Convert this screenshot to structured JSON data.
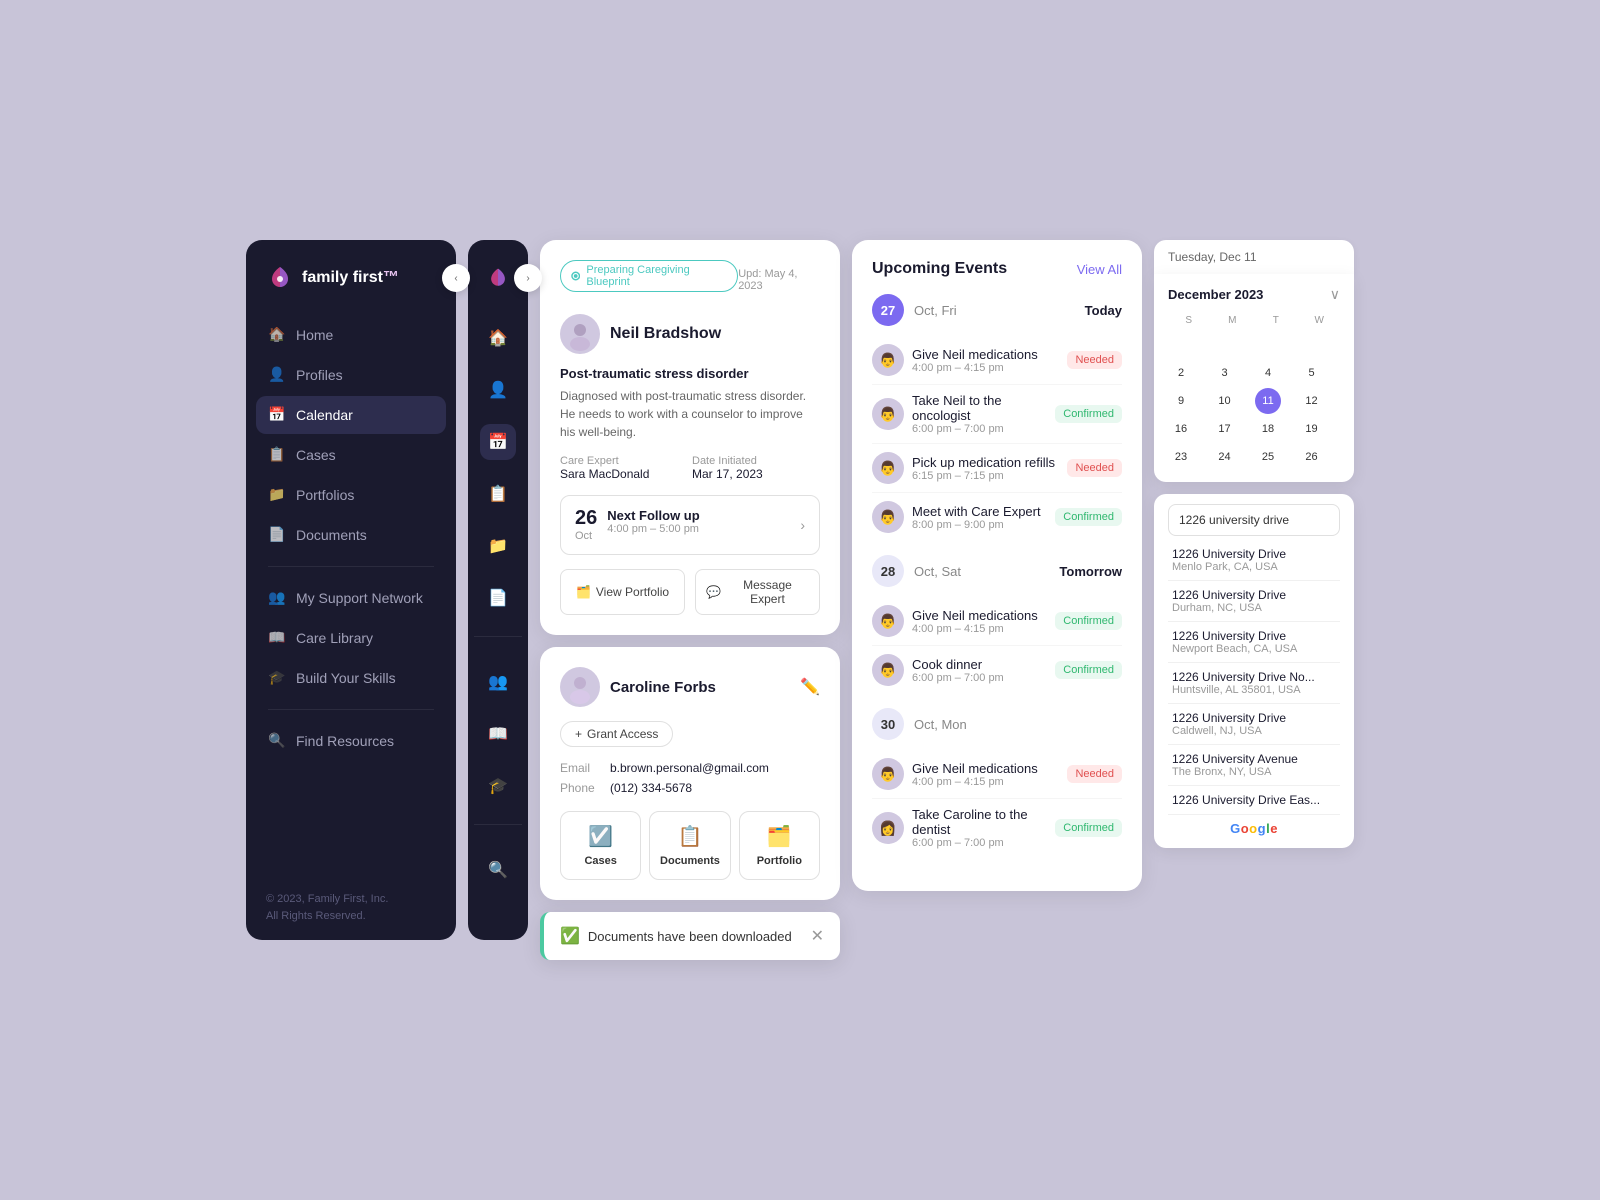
{
  "app": {
    "name": "family first",
    "trademark": "™",
    "copyright": "© 2023, Family First, Inc.\nAll Rights Reserved."
  },
  "sidebar": {
    "nav_items": [
      {
        "id": "home",
        "label": "Home",
        "icon": "🏠",
        "active": false
      },
      {
        "id": "profiles",
        "label": "Profiles",
        "icon": "👤",
        "active": false
      },
      {
        "id": "calendar",
        "label": "Calendar",
        "icon": "📅",
        "active": true
      },
      {
        "id": "cases",
        "label": "Cases",
        "icon": "📋",
        "active": false
      },
      {
        "id": "portfolios",
        "label": "Portfolios",
        "icon": "📁",
        "active": false
      },
      {
        "id": "documents",
        "label": "Documents",
        "icon": "📄",
        "active": false
      }
    ],
    "secondary_items": [
      {
        "id": "support",
        "label": "My Support Network",
        "icon": "👥",
        "active": false
      },
      {
        "id": "library",
        "label": "Care Library",
        "icon": "📖",
        "active": false
      },
      {
        "id": "skills",
        "label": "Build Your Skills",
        "icon": "🎓",
        "active": false
      }
    ],
    "tertiary_items": [
      {
        "id": "find",
        "label": "Find Resources",
        "icon": "🔍",
        "active": false
      }
    ]
  },
  "blueprint_card": {
    "tag": "Preparing Caregiving Blueprint",
    "update_date": "Upd: May 4, 2023",
    "person_name": "Neil Bradshow",
    "diagnosis_label": "Post-traumatic stress disorder",
    "diagnosis_text": "Diagnosed with post-traumatic stress disorder. He needs to work with a counselor to improve his well-being.",
    "care_expert_label": "Care Expert",
    "care_expert_value": "Sara MacDonald",
    "date_initiated_label": "Date Initiated",
    "date_initiated_value": "Mar 17, 2023",
    "followup_day": "26",
    "followup_month": "Oct",
    "followup_title": "Next Follow up",
    "followup_time": "4:00 pm – 5:00 pm",
    "view_portfolio_btn": "View Portfolio",
    "message_expert_btn": "Message Expert"
  },
  "contact_card": {
    "person_name": "Caroline Forbs",
    "grant_btn": "Grant Access",
    "email_label": "Email",
    "email_value": "b.brown.personal@gmail.com",
    "phone_label": "Phone",
    "phone_value": "(012) 334-5678",
    "actions": [
      {
        "id": "cases",
        "label": "Cases"
      },
      {
        "id": "documents",
        "label": "Documents"
      },
      {
        "id": "portfolio",
        "label": "Portfolio"
      }
    ]
  },
  "toast": {
    "message": "Documents have been downloaded"
  },
  "events": {
    "title": "Upcoming Events",
    "view_all": "View All",
    "sections": [
      {
        "day": "27",
        "date_label": "Oct, Fri",
        "day_marker": "Today",
        "items": [
          {
            "name": "Give Neil medications",
            "time": "4:00 pm – 4:15 pm",
            "status": "Needed"
          },
          {
            "name": "Take Neil to the oncologist",
            "time": "6:00 pm – 7:00 pm",
            "status": "Confirmed"
          },
          {
            "name": "Pick up medication refills",
            "time": "6:15 pm – 7:15 pm",
            "status": "Needed"
          },
          {
            "name": "Meet with Care Expert",
            "time": "8:00 pm – 9:00 pm",
            "status": "Confirmed"
          }
        ]
      },
      {
        "day": "28",
        "date_label": "Oct, Sat",
        "day_marker": "Tomorrow",
        "items": [
          {
            "name": "Give Neil medications",
            "time": "4:00 pm – 4:15 pm",
            "status": "Confirmed"
          },
          {
            "name": "Cook dinner",
            "time": "6:00 pm – 7:00 pm",
            "status": "Confirmed"
          }
        ]
      },
      {
        "day": "30",
        "date_label": "Oct, Mon",
        "day_marker": "",
        "items": [
          {
            "name": "Give Neil medications",
            "time": "4:00 pm – 4:15 pm",
            "status": "Needed"
          },
          {
            "name": "Take Caroline to the dentist",
            "time": "6:00 pm – 7:00 pm",
            "status": "Confirmed"
          }
        ]
      }
    ]
  },
  "calendar": {
    "header_date": "Tuesday, Dec 11",
    "month_year": "December  2023",
    "day_names": [
      "S",
      "M",
      "T",
      "W"
    ],
    "weeks": [
      [
        {
          "day": "",
          "state": ""
        },
        {
          "day": "",
          "state": ""
        },
        {
          "day": "",
          "state": ""
        },
        {
          "day": "",
          "state": ""
        }
      ],
      [
        {
          "day": "2",
          "state": ""
        },
        {
          "day": "3",
          "state": ""
        },
        {
          "day": "4",
          "state": ""
        },
        {
          "day": "5",
          "state": ""
        }
      ],
      [
        {
          "day": "9",
          "state": ""
        },
        {
          "day": "10",
          "state": ""
        },
        {
          "day": "11",
          "state": "today"
        },
        {
          "day": "12",
          "state": ""
        }
      ],
      [
        {
          "day": "16",
          "state": ""
        },
        {
          "day": "17",
          "state": ""
        },
        {
          "day": "18",
          "state": ""
        },
        {
          "day": "19",
          "state": ""
        }
      ],
      [
        {
          "day": "23",
          "state": ""
        },
        {
          "day": "24",
          "state": ""
        },
        {
          "day": "25",
          "state": ""
        },
        {
          "day": "26",
          "state": ""
        }
      ]
    ]
  },
  "search": {
    "placeholder": "1226 university drive",
    "results": [
      {
        "main": "1226 University Drive",
        "sub": "Menlo Park, CA, USA"
      },
      {
        "main": "1226 University Drive",
        "sub": "Durham, NC, USA"
      },
      {
        "main": "1226 University Drive",
        "sub": "Newport Beach, CA, USA"
      },
      {
        "main": "1226 University Drive No...",
        "sub": "Huntsville, AL 35801, USA"
      },
      {
        "main": "1226 University Drive",
        "sub": "Caldwell, NJ, USA"
      },
      {
        "main": "1226 University Avenue",
        "sub": "The Bronx, NY, USA"
      },
      {
        "main": "1226 University Drive Eas...",
        "sub": ""
      }
    ]
  }
}
